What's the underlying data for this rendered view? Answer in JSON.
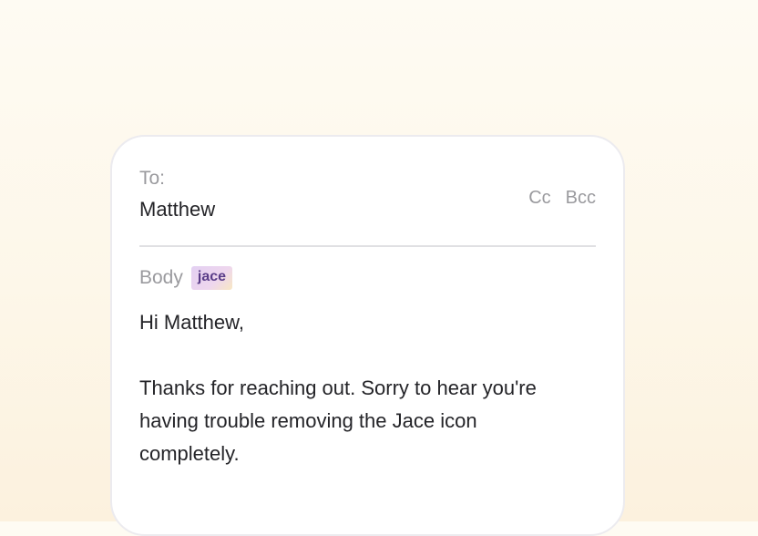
{
  "compose": {
    "to_label": "To:",
    "to_value": "Matthew",
    "cc_label": "Cc",
    "bcc_label": "Bcc",
    "body_label": "Body",
    "badge": "jace",
    "greeting": "Hi Matthew,",
    "message_lines": [
      "Thanks for reaching out. Sorry to hear you're",
      "having trouble removing the Jace icon",
      "completely."
    ]
  },
  "colors": {
    "background_top": "#fefbf3",
    "background_bottom": "#fcf1de",
    "card": "#ffffff",
    "muted_text": "#9a9a9e",
    "main_text": "#242428",
    "badge_text": "#5a3d88"
  }
}
